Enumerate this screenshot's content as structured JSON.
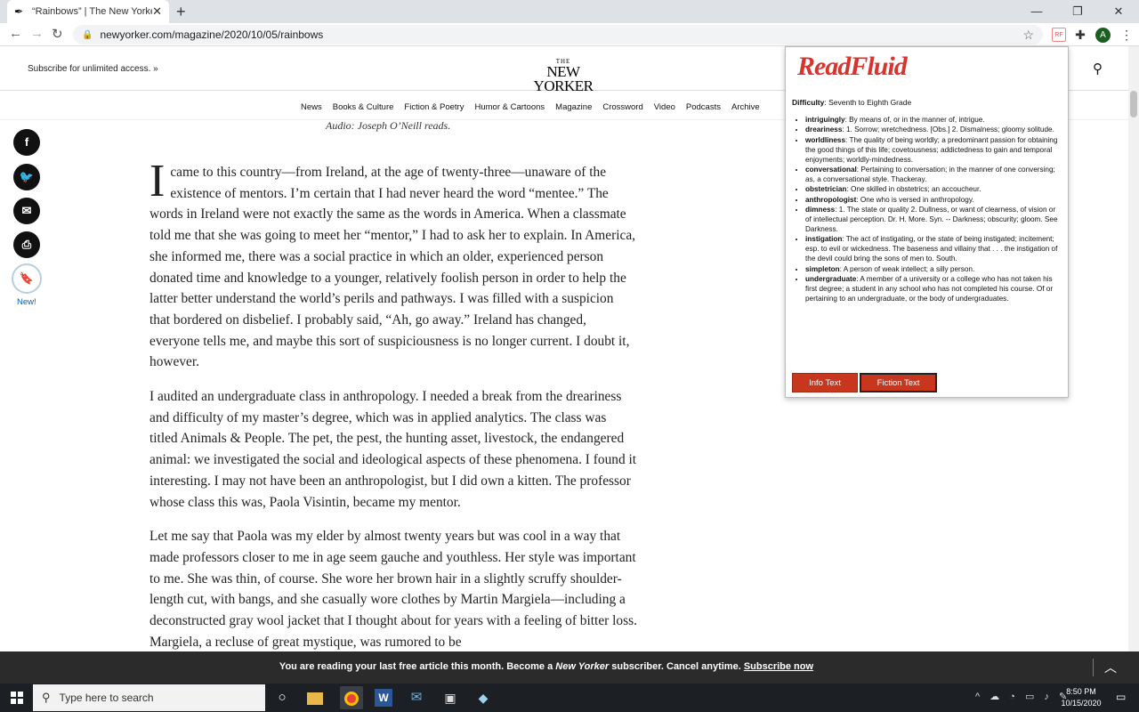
{
  "browser": {
    "tab_title": "“Rainbows” | The New Yorker",
    "url": "newyorker.com/magazine/2020/10/05/rainbows",
    "ext_rf": "RF",
    "avatar_letter": "A"
  },
  "header": {
    "subscribe": "Subscribe for unlimited access. »",
    "logo_the": "THE",
    "logo_name": "NEW YORKER"
  },
  "nav": [
    "News",
    "Books & Culture",
    "Fiction & Poetry",
    "Humor & Cartoons",
    "Magazine",
    "Crossword",
    "Video",
    "Podcasts",
    "Archive"
  ],
  "share": {
    "new_label": "New!"
  },
  "article": {
    "audio_line": "Audio: Joseph O’Neill reads.",
    "dropcap": "I",
    "p1": " came to this country—from Ireland, at the age of twenty-three—unaware of the existence of mentors. I’m certain that I had never heard the word “mentee.” The words in Ireland were not exactly the same as the words in America. When a classmate told me that she was going to meet her “mentor,” I had to ask her to explain. In America, she informed me, there was a social practice in which an older, experienced person donated time and knowledge to a younger, relatively foolish person in order to help the latter better understand the world’s perils and pathways. I was filled with a suspicion that bordered on disbelief. I probably said, “Ah, go away.” Ireland has changed, everyone tells me, and maybe this sort of suspiciousness is no longer current. I doubt it, however.",
    "p2": "I audited an undergraduate class in anthropology. I needed a break from the dreariness and difficulty of my master’s degree, which was in applied analytics. The class was titled Animals & People. The pet, the pest, the hunting asset, livestock, the endangered animal: we investigated the social and ideological aspects of these phenomena. I found it interesting. I may not have been an anthropologist, but I did own a kitten. The professor whose class this was, Paola Visintin, became my mentor.",
    "p3": "Let me say that Paola was my elder by almost twenty years but was cool in a way that made professors closer to me in age seem gauche and youthless. Her style was important to me. She was thin, of course. She wore her brown hair in a slightly scruffy shoulder-length cut, with bangs, and she casually wore clothes by Martin Margiela—including a deconstructed gray wool jacket that I thought about for years with a feeling of bitter loss. Margiela, a recluse of great mystique, was rumored to be"
  },
  "paywall": {
    "msg_start": "You are reading your last free article this month. Become a ",
    "msg_em": "New Yorker",
    "msg_mid": " subscriber. Cancel anytime. ",
    "msg_link": "Subscribe now"
  },
  "readfluid": {
    "logo": "ReadFluid",
    "difficulty_label": "Difficulty",
    "difficulty_value": ": Seventh to Eighth Grade",
    "words": [
      {
        "term": "intriguingly",
        "def": ": By means of, or in the manner of, intrigue."
      },
      {
        "term": "dreariness",
        "def": ": 1. Sorrow; wretchedness. [Obs.] 2. Dismalness; gloomy solitude."
      },
      {
        "term": "worldliness",
        "def": ": The quality of being worldly; a predominant passion for obtaining the good things of this life; covetousness; addictedness to gain and temporal enjoyments; worldly-mindedness."
      },
      {
        "term": "conversational",
        "def": ": Pertaining to conversation; in the manner of one conversing; as, a conversational style. Thackeray."
      },
      {
        "term": "obstetrician",
        "def": ": One skilled in obstetrics; an accoucheur."
      },
      {
        "term": "anthropologist",
        "def": ": One who is versed in anthropology."
      },
      {
        "term": "dimness",
        "def": ": 1. The state or quality 2. Dullness, or want of clearness, of vision or of intellectual perception. Dr. H. More. Syn. -- Darkness; obscurity; gloom. See Darkness."
      },
      {
        "term": "instigation",
        "def": ": The act of instigating, or the state of being instigated; incitement; esp. to evil or wickedness. The baseness and villainy that . . . the instigation of the devil could bring the sons of men to. South."
      },
      {
        "term": "simpleton",
        "def": ": A person of weak intellect; a silly person."
      },
      {
        "term": "undergraduate",
        "def": ": A member of a university or a college who has not taken his first degree; a student in any school who has not completed his course. Of or pertaining to an undergraduate, or the body of undergraduates."
      }
    ],
    "btn_info": "Info Text",
    "btn_fiction": "Fiction Text"
  },
  "taskbar": {
    "search_placeholder": "Type here to search",
    "time": "8:50 PM",
    "date": "10/15/2020"
  }
}
